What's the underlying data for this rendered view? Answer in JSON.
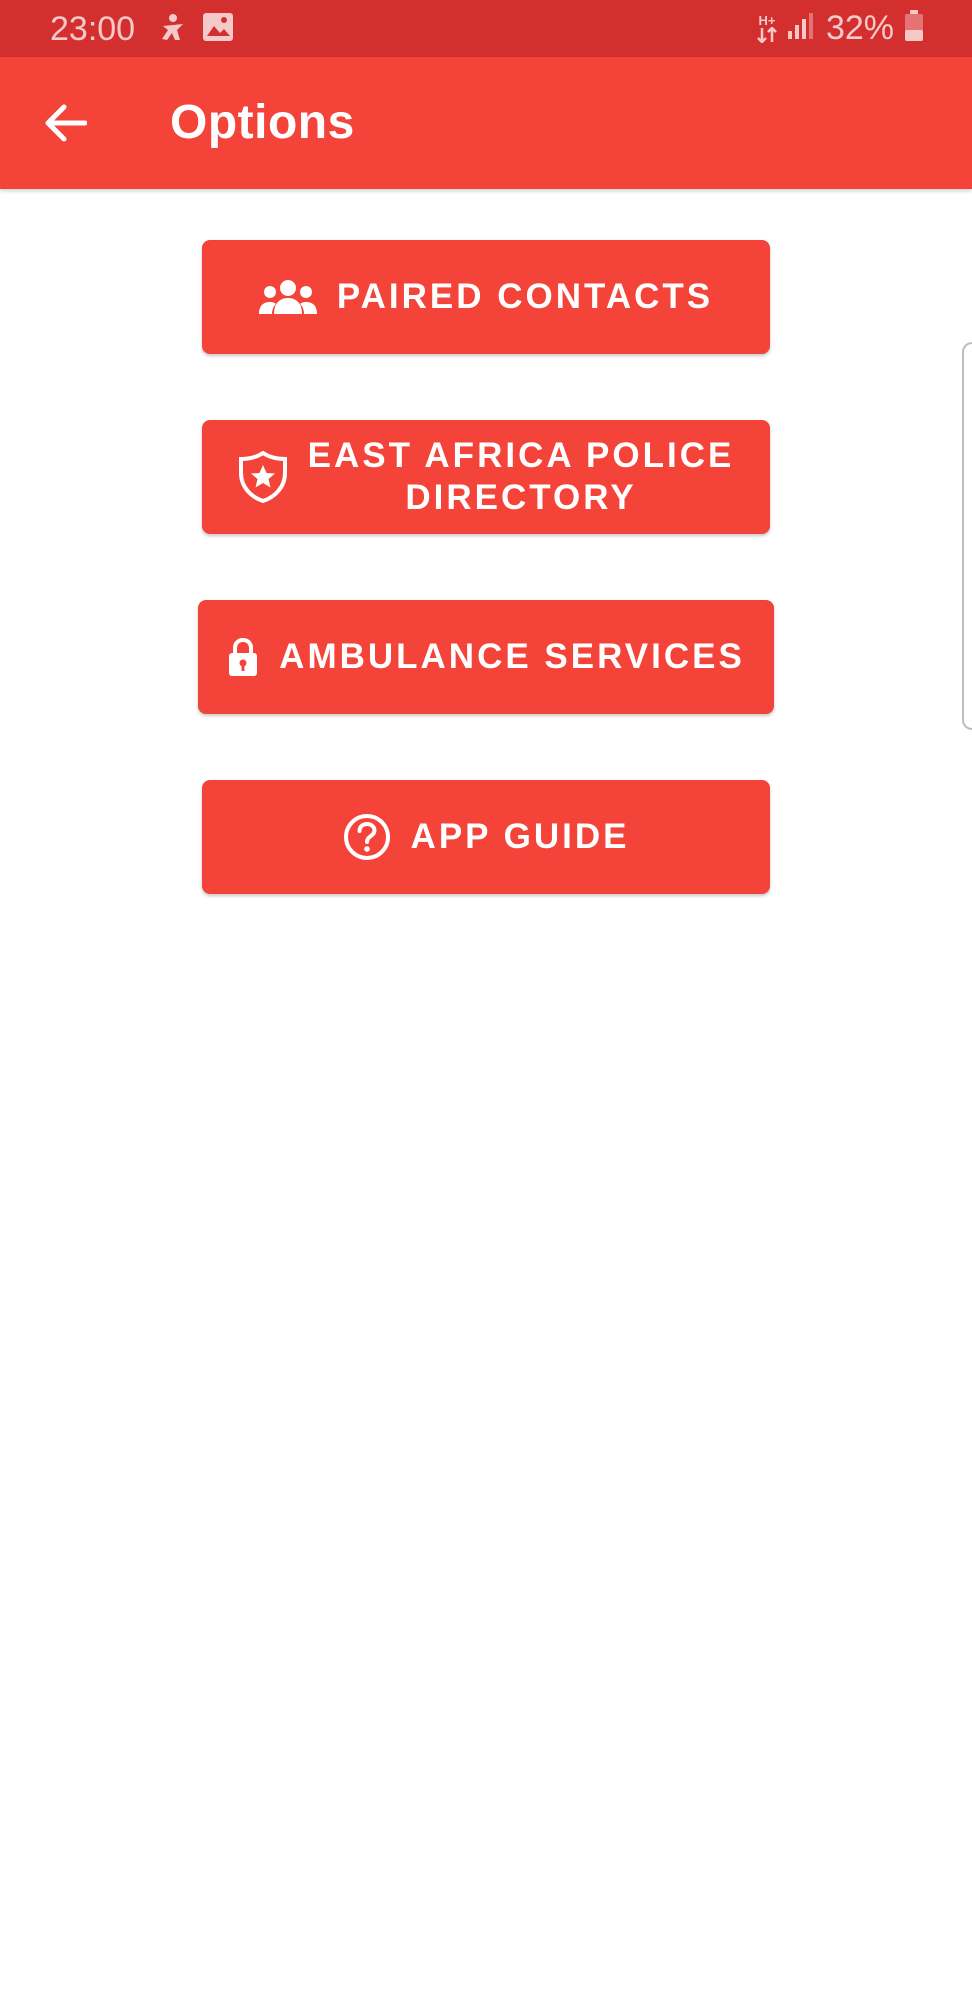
{
  "status_bar": {
    "time": "23:00",
    "network": "H+",
    "battery": "32%",
    "icons": [
      "accessibility-icon",
      "image-icon",
      "data-arrows-icon",
      "signal-icon",
      "battery-icon"
    ]
  },
  "app_bar": {
    "title": "Options",
    "back_icon": "arrow-back-icon"
  },
  "menu": {
    "items": [
      {
        "label": "PAIRED CONTACTS",
        "icon": "people-icon"
      },
      {
        "label": "EAST AFRICA POLICE\nDIRECTORY",
        "icon": "police-badge-icon"
      },
      {
        "label": "AMBULANCE SERVICES",
        "icon": "lock-icon"
      },
      {
        "label": "APP GUIDE",
        "icon": "help-circle-icon"
      }
    ]
  },
  "colors": {
    "status_bar": "#d32f2f",
    "primary": "#f44338",
    "on_primary": "#ffffff",
    "background": "#ffffff"
  }
}
